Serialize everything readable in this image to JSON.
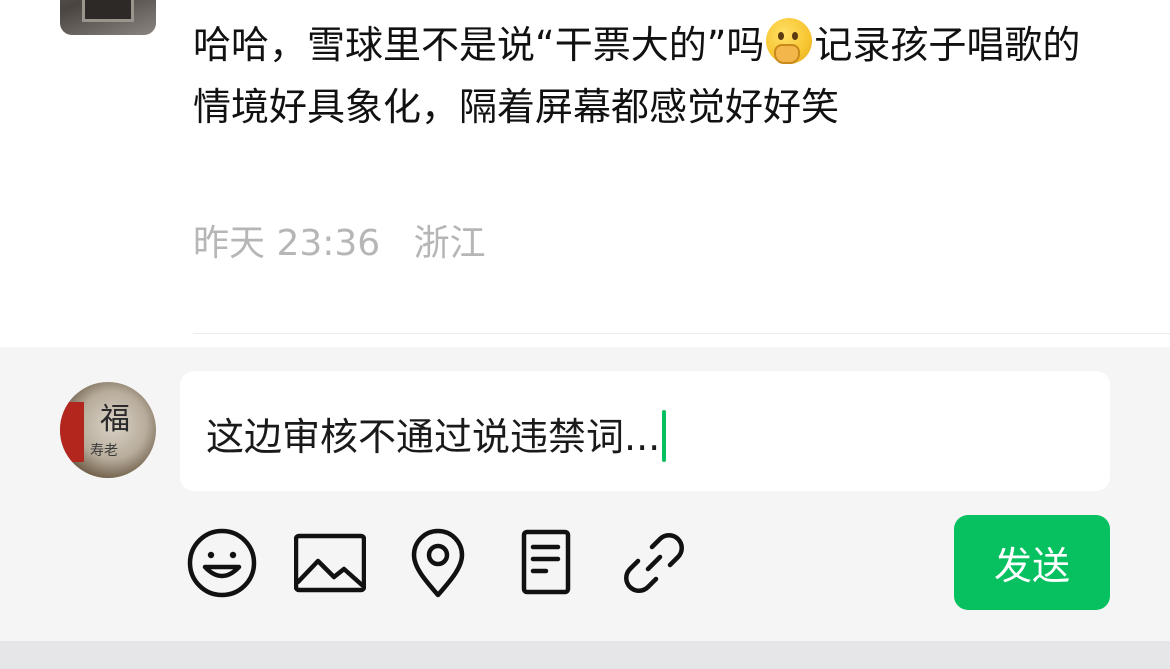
{
  "comment": {
    "text_part1": "哈哈，雪球里不是说“干票大的”吗",
    "emoji": "thinking-face-emoji",
    "text_part2": "记录孩子唱歌的情境好具象化，隔着屏幕都感觉好好笑",
    "time": "昨天 23:36",
    "location": "浙江"
  },
  "composer": {
    "input_value": "这边审核不通过说违禁词...",
    "accent_color": "#07c160",
    "toolbar": [
      "emoji-icon",
      "image-icon",
      "location-icon",
      "document-icon",
      "link-icon"
    ],
    "send_label": "发送"
  }
}
